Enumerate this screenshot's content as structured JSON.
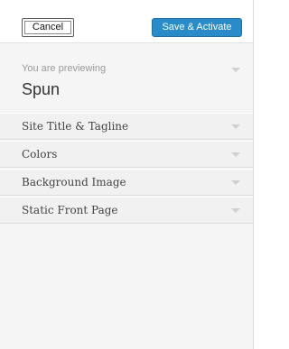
{
  "header": {
    "cancel_label": "Cancel",
    "save_label": "Save & Activate"
  },
  "preview": {
    "label": "You are previewing",
    "theme_name": "Spun"
  },
  "sections": [
    {
      "label": "Site Title & Tagline",
      "icon": "chevron-down-icon"
    },
    {
      "label": "Colors",
      "icon": "chevron-down-icon"
    },
    {
      "label": "Background Image",
      "icon": "chevron-down-icon"
    },
    {
      "label": "Static Front Page",
      "icon": "chevron-down-icon"
    }
  ],
  "colors": {
    "accent": "#2a8bc9",
    "panel_background": "#f5f5f5",
    "section_background": "#f1f1f1"
  }
}
